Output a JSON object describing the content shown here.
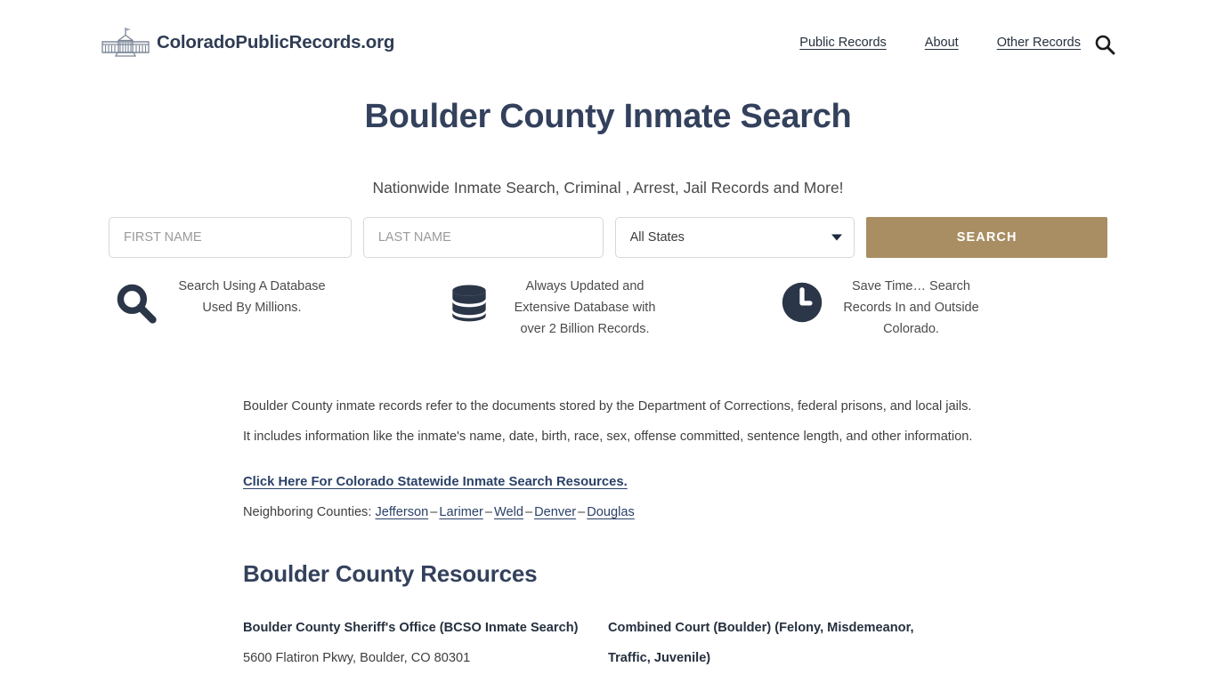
{
  "header": {
    "brand_name": "ColoradoPublicRecords.org",
    "logo_icon": "capitol-building-icon",
    "nav": [
      {
        "label": "Public Records"
      },
      {
        "label": "About"
      },
      {
        "label": "Other Records"
      }
    ],
    "search_icon": "search-icon"
  },
  "hero": {
    "title": "Boulder County Inmate Search",
    "subtitle": "Nationwide Inmate Search, Criminal , Arrest, Jail Records and More!"
  },
  "search_form": {
    "first_name_placeholder": "FIRST NAME",
    "first_name_value": "",
    "last_name_placeholder": "LAST NAME",
    "last_name_value": "",
    "state_selected": "All States",
    "state_options": [
      "All States"
    ],
    "submit_label": "SEARCH",
    "submit_color": "#a98e63"
  },
  "features": [
    {
      "icon": "magnifier-icon",
      "text": "Search Using A Database Used By Millions."
    },
    {
      "icon": "database-icon",
      "text": "Always Updated and Extensive Database with over 2 Billion Records."
    },
    {
      "icon": "clock-icon",
      "text": "Save Time… Search Records In and Outside Colorado."
    }
  ],
  "article": {
    "paragraph": "Boulder County inmate records refer to the documents stored by the Department of Corrections, federal prisons, and local jails. It includes information like the inmate's name, date, birth, race, sex, offense committed, sentence length, and other information.",
    "statewide_link": "Click Here For Colorado Statewide Inmate Search Resources.",
    "neighbors_label": "Neighboring Counties:",
    "neighbors": [
      "Jefferson",
      "Larimer",
      "Weld",
      "Denver",
      "Douglas"
    ],
    "neighbors_separator": "–"
  },
  "resources": {
    "heading": "Boulder County Resources",
    "items": [
      {
        "name": "Boulder County Sheriff's Office (BCSO Inmate Search)",
        "address": "5600 Flatiron Pkwy, Boulder, CO 80301"
      },
      {
        "name": "Combined Court (Boulder) (Felony, Misdemeanor, Traffic, Juvenile)",
        "address": ""
      }
    ]
  },
  "theme": {
    "title_color": "#33415c",
    "accent_color": "#a98e63",
    "link_color": "#2b4168",
    "icon_color": "#2b3648"
  }
}
